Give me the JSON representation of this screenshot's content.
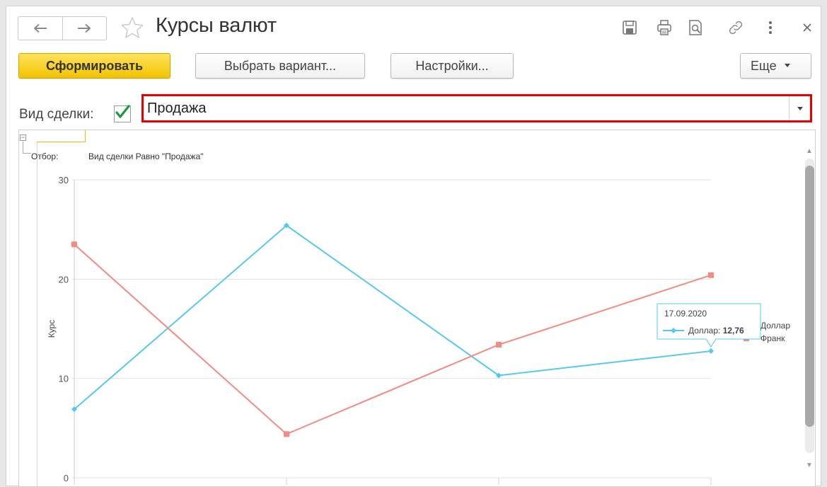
{
  "window": {
    "title": "Курсы валют"
  },
  "toolbar": {
    "generate_label": "Сформировать",
    "choose_variant_label": "Выбрать вариант...",
    "settings_label": "Настройки...",
    "more_label": "Еще"
  },
  "filter": {
    "label": "Вид сделки:",
    "checked": true,
    "value": "Продажа"
  },
  "report": {
    "filter_prefix": "Отбор:",
    "filter_text": "Вид сделки Равно \"Продажа\""
  },
  "colors": {
    "primary_button": "#f4c800",
    "highlight_border": "#e60000",
    "dollar_series": "#55c8f0",
    "franc_series": "#f58a80",
    "checkmark": "#1a9a3a"
  },
  "icons": [
    "back-arrow-icon",
    "forward-arrow-icon",
    "star-icon",
    "save-icon",
    "print-icon",
    "preview-icon",
    "link-icon",
    "more-vertical-icon",
    "close-icon",
    "chevron-down-icon",
    "checkmark-icon"
  ],
  "chart_data": {
    "type": "line",
    "title": "",
    "ylabel": "Курс",
    "xlabel": "",
    "ylim": [
      0,
      30
    ],
    "yticks": [
      0,
      10,
      20,
      30
    ],
    "grid": true,
    "legend_position": "right",
    "series": [
      {
        "name": "Доллар",
        "color": "#55c8f0",
        "marker": "diamond",
        "values": [
          6.9,
          25.4,
          10.3,
          12.76
        ]
      },
      {
        "name": "Франк",
        "color": "#f58a80",
        "marker": "square",
        "values": [
          23.5,
          4.4,
          13.4,
          20.4
        ]
      }
    ],
    "tooltip": {
      "date": "17.09.2020",
      "series": "Доллар",
      "label": "Доллар:",
      "value": "12,76",
      "point_index": 3
    }
  }
}
